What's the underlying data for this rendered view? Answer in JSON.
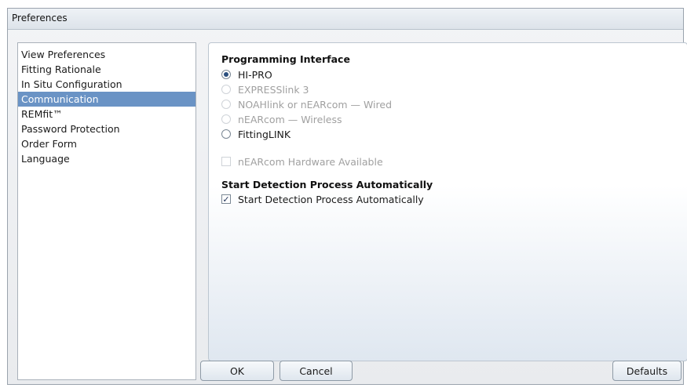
{
  "window": {
    "title": "Preferences"
  },
  "sidebar": {
    "items": [
      {
        "label": "View Preferences",
        "selected": false
      },
      {
        "label": "Fitting Rationale",
        "selected": false
      },
      {
        "label": "In Situ Configuration",
        "selected": false
      },
      {
        "label": "Communication",
        "selected": true
      },
      {
        "label": "REMfit™",
        "selected": false
      },
      {
        "label": "Password Protection",
        "selected": false
      },
      {
        "label": "Order Form",
        "selected": false
      },
      {
        "label": "Language",
        "selected": false
      }
    ]
  },
  "programming": {
    "heading": "Programming Interface",
    "options": [
      {
        "label": "HI-PRO",
        "checked": true,
        "enabled": true
      },
      {
        "label": "EXPRESSlink 3",
        "checked": false,
        "enabled": false
      },
      {
        "label": "NOAHlink or nEARcom — Wired",
        "checked": false,
        "enabled": false
      },
      {
        "label": "nEARcom — Wireless",
        "checked": false,
        "enabled": false
      },
      {
        "label": "FittingLINK",
        "checked": false,
        "enabled": true
      }
    ],
    "hardware_checkbox": {
      "label": "nEARcom Hardware Available",
      "checked": false,
      "enabled": false
    }
  },
  "detection": {
    "heading": "Start Detection Process Automatically",
    "checkbox": {
      "label": "Start Detection Process Automatically",
      "checked": true,
      "enabled": true
    }
  },
  "buttons": {
    "ok": "OK",
    "cancel": "Cancel",
    "defaults": "Defaults"
  },
  "colors": {
    "selection": "#6a93c5",
    "disabled_text": "#a0a0a0"
  }
}
